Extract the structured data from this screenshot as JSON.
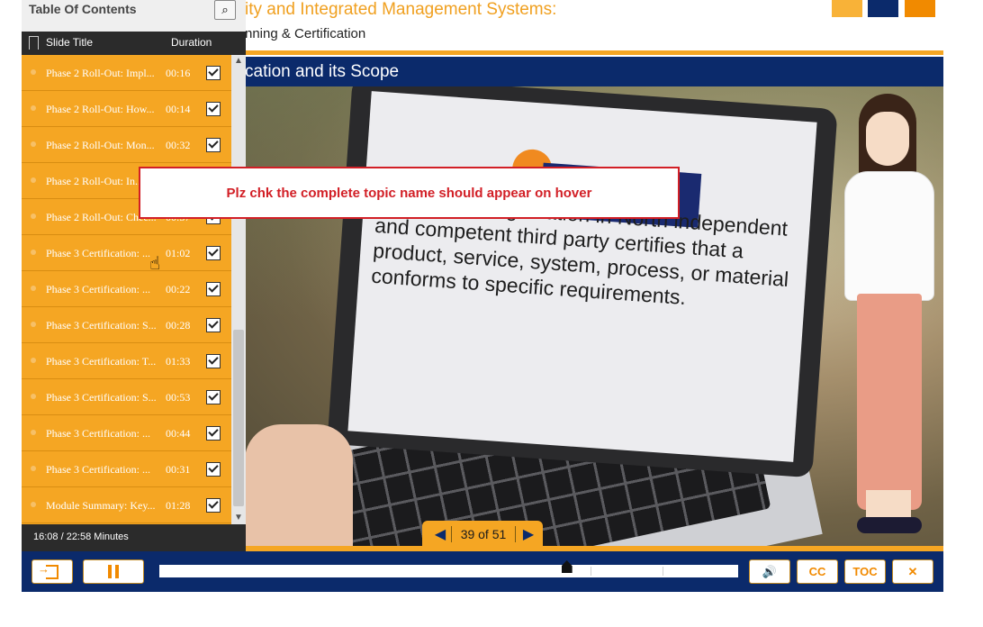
{
  "header": {
    "course_title": "ity and Integrated Management Systems:",
    "course_subtitle": "nning & Certification",
    "slide_title": "cation and its Scope"
  },
  "slide": {
    "screen_text": "America, or registration in North independent and competent third party certifies that a product, service, system, process, or material conforms to specific requirements.",
    "counter": "39 of 51",
    "prev_icon": "◀",
    "next_icon": "▶"
  },
  "toc": {
    "title": "Table Of Contents",
    "search_icon": "⌕",
    "col_title": "Slide Title",
    "col_duration": "Duration",
    "rows": [
      {
        "title": "Phase 2 Roll-Out: Impl...",
        "duration": "00:16",
        "checked": true
      },
      {
        "title": "Phase 2 Roll-Out: How...",
        "duration": "00:14",
        "checked": true
      },
      {
        "title": "Phase 2 Roll-Out: Mon...",
        "duration": "00:32",
        "checked": true
      },
      {
        "title": "Phase 2 Roll-Out: In...",
        "duration": "",
        "checked": true
      },
      {
        "title": "Phase 2 Roll-Out: Chec...",
        "duration": "00:37",
        "checked": true
      },
      {
        "title": "Phase 3 Certification: ...",
        "duration": "01:02",
        "checked": true
      },
      {
        "title": "Phase 3 Certification: ...",
        "duration": "00:22",
        "checked": true
      },
      {
        "title": "Phase 3 Certification: S...",
        "duration": "00:28",
        "checked": true
      },
      {
        "title": "Phase 3 Certification: T...",
        "duration": "01:33",
        "checked": true
      },
      {
        "title": "Phase 3 Certification: S...",
        "duration": "00:53",
        "checked": true
      },
      {
        "title": "Phase 3 Certification: ...",
        "duration": "00:44",
        "checked": true
      },
      {
        "title": "Phase 3 Certification: ...",
        "duration": "00:31",
        "checked": true
      },
      {
        "title": "Module Summary: Key...",
        "duration": "01:28",
        "checked": true
      }
    ],
    "elapsed": "16:08 / 22:58 Minutes"
  },
  "controls": {
    "cc_label": "CC",
    "toc_label": "TOC",
    "close_label": "✕",
    "volume_icon": "🔊",
    "progress_fraction": 0.704
  },
  "annotation": {
    "text": "Plz chk the complete topic name should appear on hover"
  },
  "colors": {
    "accent_orange": "#f5a623",
    "brand_navy": "#0b2a6b",
    "annotation_red": "#d21f26"
  }
}
